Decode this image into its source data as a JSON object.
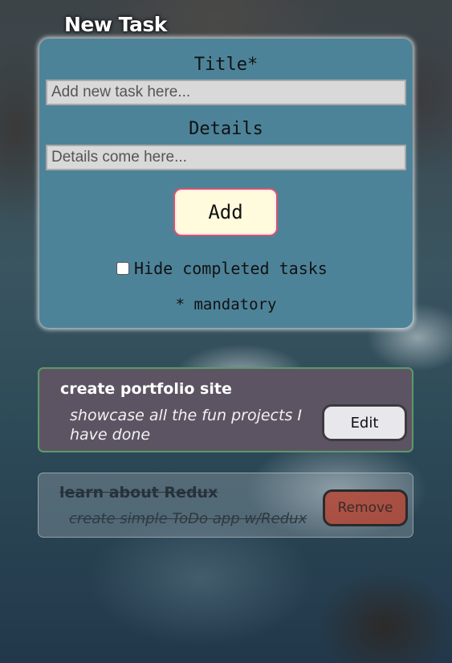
{
  "page": {
    "heading": "New Task"
  },
  "form": {
    "title_label": "Title*",
    "title_placeholder": "Add new task here...",
    "title_value": "",
    "details_label": "Details",
    "details_placeholder": "Details come here...",
    "details_value": "",
    "add_button": "Add",
    "hide_completed_label": "Hide completed tasks",
    "hide_completed_checked": false,
    "mandatory_note": "* mandatory"
  },
  "tasks": [
    {
      "title": "create portfolio site",
      "details": "showcase all the fun projects I have done",
      "completed": false,
      "action": "Edit"
    },
    {
      "title": "learn about Redux",
      "details": "create simple ToDo app w/Redux",
      "completed": true,
      "action": "Remove"
    }
  ],
  "colors": {
    "form_card": "#4d8399",
    "task_active": "#5d5463",
    "add_button": "#fffbdc",
    "remove_button": "#b44837"
  }
}
